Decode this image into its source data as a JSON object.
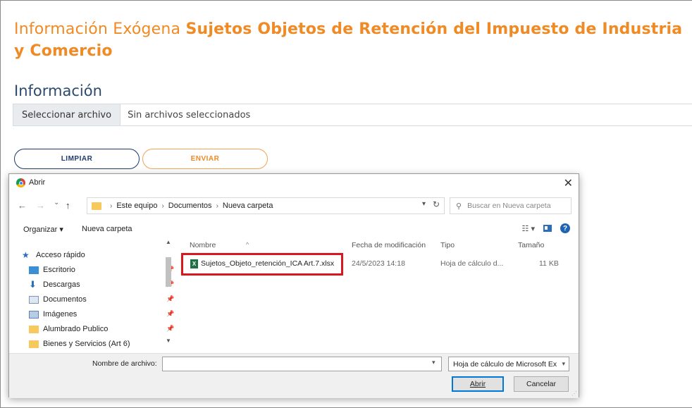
{
  "page": {
    "title_light": "Información Exógena",
    "title_bold": "Sujetos Objetos de Retención del Impuesto de Industria y Comercio",
    "section_title": "Información",
    "file_button": "Seleccionar archivo",
    "file_status": "Sin archivos seleccionados",
    "btn_limpiar": "LIMPIAR",
    "btn_enviar": "ENVIAR"
  },
  "dialog": {
    "title": "Abrir",
    "close": "✕",
    "nav_back": "←",
    "nav_forward": "→",
    "nav_recent": "⌄",
    "nav_up": "↑",
    "breadcrumb": [
      "Este equipo",
      "Documentos",
      "Nueva carpeta"
    ],
    "breadcrumb_sep": "›",
    "search_placeholder": "Buscar en Nueva carpeta",
    "toolbar": {
      "organizar": "Organizar ▾",
      "nueva_carpeta": "Nueva carpeta"
    },
    "nav_items": [
      {
        "label": "Acceso rápido",
        "icon": "star-icon"
      },
      {
        "label": "Escritorio",
        "icon": "desktop-icon"
      },
      {
        "label": "Descargas",
        "icon": "download-icon"
      },
      {
        "label": "Documentos",
        "icon": "document-icon"
      },
      {
        "label": "Imágenes",
        "icon": "image-icon"
      },
      {
        "label": "Alumbrado Publico",
        "icon": "folder-icon"
      },
      {
        "label": "Bienes y Servicios (Art 6)",
        "icon": "folder-icon"
      }
    ],
    "columns": {
      "name": "Nombre",
      "modified": "Fecha de modificación",
      "type": "Tipo",
      "size": "Tamaño"
    },
    "files": [
      {
        "name": "Sujetos_Objeto_retención_ICA  Art.7.xlsx",
        "modified": "24/5/2023 14:18",
        "type": "Hoja de cálculo d...",
        "size": "11 KB"
      }
    ],
    "filename_label": "Nombre de archivo:",
    "filename_value": "",
    "file_type": "Hoja de cálculo de Microsoft Ex",
    "btn_abrir": "Abrir",
    "btn_cancelar": "Cancelar"
  },
  "colors": {
    "accent_orange": "#f08a24",
    "navy": "#1e3a6a",
    "highlight_red": "#d9171e"
  }
}
